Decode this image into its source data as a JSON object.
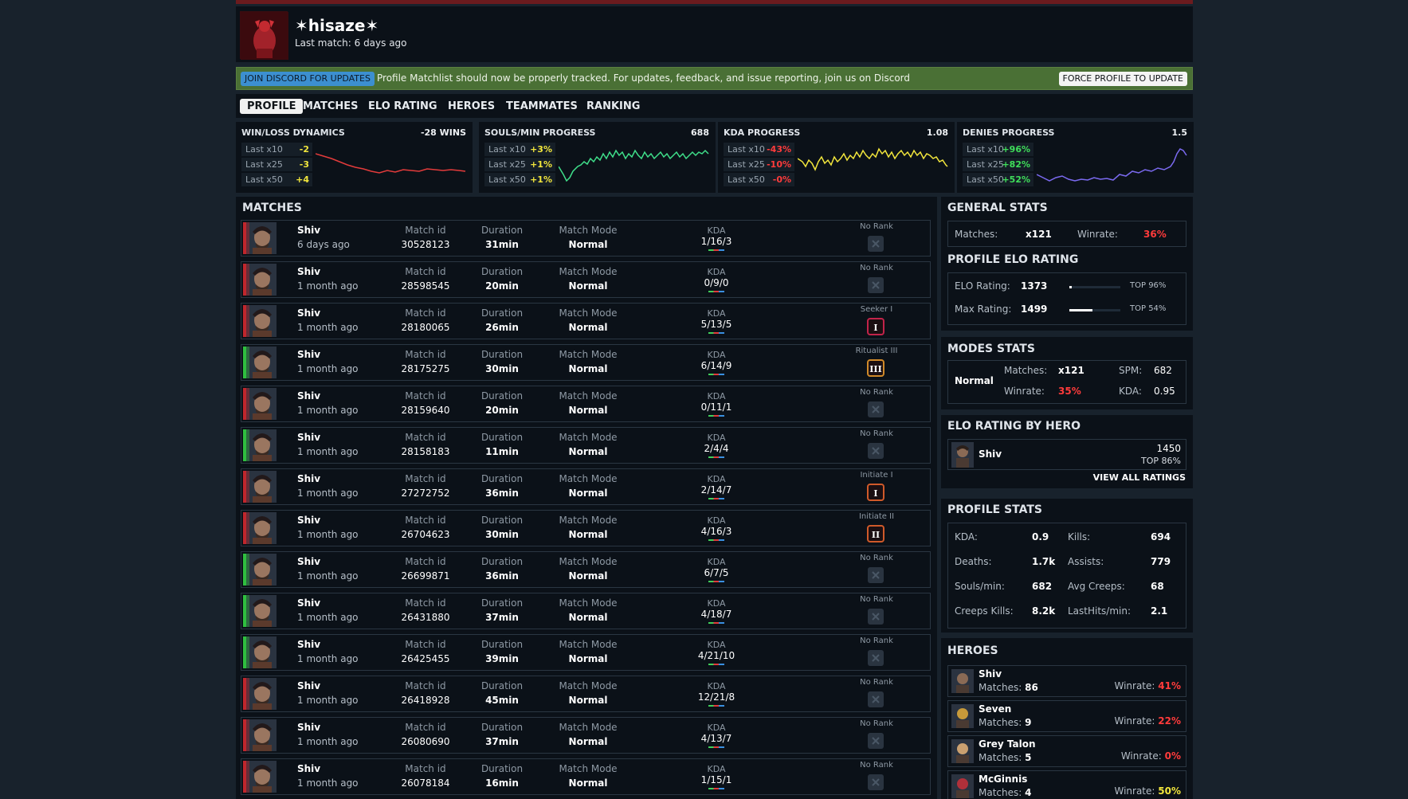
{
  "header": {
    "player_name": "✶hisaze✶",
    "last_match": "Last match: 6 days ago"
  },
  "banner": {
    "discord_button": "JOIN DISCORD FOR UPDATES",
    "text": "Profile Matchlist should now be properly tracked. For updates, feedback, and issue reporting, join us on Discord",
    "force_button": "FORCE PROFILE TO UPDATE"
  },
  "nav": {
    "tabs": [
      "PROFILE",
      "MATCHES",
      "ELO RATING",
      "HEROES",
      "TEAMMATES",
      "RANKING"
    ],
    "active": "PROFILE"
  },
  "progress": [
    {
      "title": "WIN/LOSS DYNAMICS",
      "value": "-28 WINS",
      "color": "#e33b3b",
      "rows": [
        {
          "label": "Last x10",
          "value": "-2",
          "color": "#f2e63c"
        },
        {
          "label": "Last x25",
          "value": "-3",
          "color": "#f2e63c"
        },
        {
          "label": "Last x50",
          "value": "+4",
          "color": "#f2e63c"
        }
      ]
    },
    {
      "title": "SOULS/MIN PROGRESS",
      "value": "688",
      "color": "#3fdf8a",
      "rows": [
        {
          "label": "Last x10",
          "value": "+3%",
          "color": "#f2e63c"
        },
        {
          "label": "Last x25",
          "value": "+1%",
          "color": "#f2e63c"
        },
        {
          "label": "Last x50",
          "value": "+1%",
          "color": "#f2e63c"
        }
      ]
    },
    {
      "title": "KDA PROGRESS",
      "value": "1.08",
      "color": "#f2e63c",
      "rows": [
        {
          "label": "Last x10",
          "value": "-43%",
          "color": "#ff3b3b"
        },
        {
          "label": "Last x25",
          "value": "-10%",
          "color": "#ff3b3b"
        },
        {
          "label": "Last x50",
          "value": "-0%",
          "color": "#ff3b3b"
        }
      ]
    },
    {
      "title": "DENIES PROGRESS",
      "value": "1.5",
      "color": "#7b6af0",
      "rows": [
        {
          "label": "Last x10",
          "value": "+96%",
          "color": "#3fdf5a"
        },
        {
          "label": "Last x25",
          "value": "+82%",
          "color": "#3fdf5a"
        },
        {
          "label": "Last x50",
          "value": "+52%",
          "color": "#3fdf5a"
        }
      ]
    }
  ],
  "matches": {
    "title": "MATCHES",
    "labels": {
      "match_id": "Match id",
      "duration": "Duration",
      "mode": "Match Mode",
      "kda": "KDA"
    },
    "rows": [
      {
        "hero": "Shiv",
        "time": "6 days ago",
        "id": "30528123",
        "duration": "31min",
        "mode": "Normal",
        "k": "1",
        "d": "16",
        "a": "3",
        "rank": "No Rank",
        "rank_icon": "x",
        "win": false
      },
      {
        "hero": "Shiv",
        "time": "1 month ago",
        "id": "28598545",
        "duration": "20min",
        "mode": "Normal",
        "k": "0",
        "d": "9",
        "a": "0",
        "rank": "No Rank",
        "rank_icon": "x",
        "win": false
      },
      {
        "hero": "Shiv",
        "time": "1 month ago",
        "id": "28180065",
        "duration": "26min",
        "mode": "Normal",
        "k": "5",
        "d": "13",
        "a": "5",
        "rank": "Seeker I",
        "rank_icon": "I",
        "win": false
      },
      {
        "hero": "Shiv",
        "time": "1 month ago",
        "id": "28175275",
        "duration": "30min",
        "mode": "Normal",
        "k": "6",
        "d": "14",
        "a": "9",
        "rank": "Ritualist III",
        "rank_icon": "III",
        "win": true
      },
      {
        "hero": "Shiv",
        "time": "1 month ago",
        "id": "28159640",
        "duration": "20min",
        "mode": "Normal",
        "k": "0",
        "d": "11",
        "a": "1",
        "rank": "No Rank",
        "rank_icon": "x",
        "win": false
      },
      {
        "hero": "Shiv",
        "time": "1 month ago",
        "id": "28158183",
        "duration": "11min",
        "mode": "Normal",
        "k": "2",
        "d": "4",
        "a": "4",
        "rank": "No Rank",
        "rank_icon": "x",
        "win": true
      },
      {
        "hero": "Shiv",
        "time": "1 month ago",
        "id": "27272752",
        "duration": "36min",
        "mode": "Normal",
        "k": "2",
        "d": "14",
        "a": "7",
        "rank": "Initiate I",
        "rank_icon": "I",
        "win": false
      },
      {
        "hero": "Shiv",
        "time": "1 month ago",
        "id": "26704623",
        "duration": "30min",
        "mode": "Normal",
        "k": "4",
        "d": "16",
        "a": "3",
        "rank": "Initiate II",
        "rank_icon": "II",
        "win": false
      },
      {
        "hero": "Shiv",
        "time": "1 month ago",
        "id": "26699871",
        "duration": "36min",
        "mode": "Normal",
        "k": "6",
        "d": "7",
        "a": "5",
        "rank": "No Rank",
        "rank_icon": "x",
        "win": true
      },
      {
        "hero": "Shiv",
        "time": "1 month ago",
        "id": "26431880",
        "duration": "37min",
        "mode": "Normal",
        "k": "4",
        "d": "18",
        "a": "7",
        "rank": "No Rank",
        "rank_icon": "x",
        "win": true
      },
      {
        "hero": "Shiv",
        "time": "1 month ago",
        "id": "26425455",
        "duration": "39min",
        "mode": "Normal",
        "k": "4",
        "d": "21",
        "a": "10",
        "rank": "No Rank",
        "rank_icon": "x",
        "win": true
      },
      {
        "hero": "Shiv",
        "time": "1 month ago",
        "id": "26418928",
        "duration": "45min",
        "mode": "Normal",
        "k": "12",
        "d": "21",
        "a": "8",
        "rank": "No Rank",
        "rank_icon": "x",
        "win": false
      },
      {
        "hero": "Shiv",
        "time": "1 month ago",
        "id": "26080690",
        "duration": "37min",
        "mode": "Normal",
        "k": "4",
        "d": "13",
        "a": "7",
        "rank": "No Rank",
        "rank_icon": "x",
        "win": false
      },
      {
        "hero": "Shiv",
        "time": "1 month ago",
        "id": "26078184",
        "duration": "16min",
        "mode": "Normal",
        "k": "1",
        "d": "15",
        "a": "1",
        "rank": "No Rank",
        "rank_icon": "x",
        "win": false
      }
    ]
  },
  "general_stats": {
    "title": "GENERAL STATS",
    "matches_label": "Matches:",
    "matches": "x121",
    "winrate_label": "Winrate:",
    "winrate": "36%"
  },
  "elo": {
    "title": "PROFILE ELO RATING",
    "rating_label": "ELO Rating:",
    "rating": "1373",
    "rating_top": "TOP 96%",
    "rating_fill": 0.04,
    "max_label": "Max Rating:",
    "max": "1499",
    "max_top": "TOP 54%",
    "max_fill": 0.46
  },
  "modes": {
    "title": "MODES STATS",
    "mode": "Normal",
    "matches_label": "Matches:",
    "matches": "x121",
    "spm_label": "SPM:",
    "spm": "682",
    "winrate_label": "Winrate:",
    "winrate": "35%",
    "kda_label": "KDA:",
    "kda": "0.95"
  },
  "elo_hero": {
    "title": "ELO RATING BY HERO",
    "hero": "Shiv",
    "rating": "1450",
    "top": "TOP 86%",
    "view_all": "VIEW ALL RATINGS"
  },
  "profile_stats": {
    "title": "PROFILE STATS",
    "rows": [
      [
        {
          "label": "KDA:",
          "value": "0.9"
        },
        {
          "label": "Kills:",
          "value": "694"
        }
      ],
      [
        {
          "label": "Deaths:",
          "value": "1.7k"
        },
        {
          "label": "Assists:",
          "value": "779"
        }
      ],
      [
        {
          "label": "Souls/min:",
          "value": "682"
        },
        {
          "label": "Avg Creeps:",
          "value": "68"
        }
      ],
      [
        {
          "label": "Creeps Kills:",
          "value": "8.2k"
        },
        {
          "label": "LastHits/min:",
          "value": "2.1"
        }
      ]
    ]
  },
  "heroes": {
    "title": "HEROES",
    "matches_label": "Matches:",
    "winrate_label": "Winrate:",
    "rows": [
      {
        "name": "Shiv",
        "matches": "86",
        "winrate": "41%",
        "color": "#ff3b3b"
      },
      {
        "name": "Seven",
        "matches": "9",
        "winrate": "22%",
        "color": "#ff3b3b"
      },
      {
        "name": "Grey Talon",
        "matches": "5",
        "winrate": "0%",
        "color": "#ff3b3b"
      },
      {
        "name": "McGinnis",
        "matches": "4",
        "winrate": "50%",
        "color": "#f2e63c"
      }
    ]
  }
}
